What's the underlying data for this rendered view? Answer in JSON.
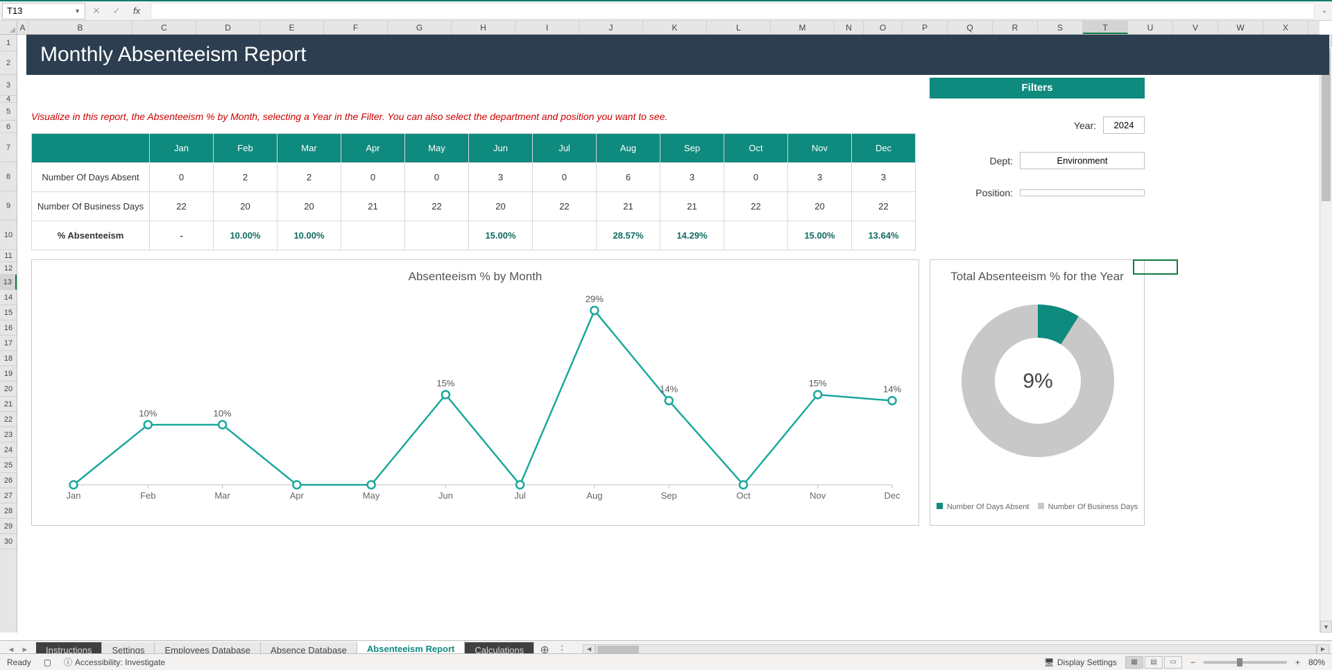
{
  "nameBox": "T13",
  "formulaBarValue": "",
  "columns": [
    "A",
    "B",
    "C",
    "D",
    "E",
    "F",
    "G",
    "H",
    "I",
    "J",
    "K",
    "L",
    "M",
    "N",
    "O",
    "P",
    "Q",
    "R",
    "S",
    "T",
    "U",
    "V",
    "W",
    "X"
  ],
  "selectedCol": "T",
  "rows": [
    1,
    2,
    3,
    4,
    5,
    6,
    7,
    8,
    9,
    10,
    11,
    12,
    13,
    14,
    15,
    16,
    17,
    18,
    19,
    20,
    21,
    22,
    23,
    24,
    25,
    26,
    27,
    28,
    29,
    30
  ],
  "selectedRow": 13,
  "title": "Monthly Absenteeism Report",
  "instruction": "Visualize in this report, the Absenteeism % by Month, selecting a Year in the Filter. You can also select the department and position you want to see.",
  "months": [
    "Jan",
    "Feb",
    "Mar",
    "Apr",
    "May",
    "Jun",
    "Jul",
    "Aug",
    "Sep",
    "Oct",
    "Nov",
    "Dec"
  ],
  "tableRows": {
    "absent": {
      "label": "Number Of Days Absent",
      "vals": [
        "0",
        "2",
        "2",
        "0",
        "0",
        "3",
        "0",
        "6",
        "3",
        "0",
        "3",
        "3"
      ]
    },
    "business": {
      "label": "Number Of Business Days",
      "vals": [
        "22",
        "20",
        "20",
        "21",
        "22",
        "20",
        "22",
        "21",
        "21",
        "22",
        "20",
        "22"
      ]
    },
    "pct": {
      "label": "% Absenteeism",
      "vals": [
        "-",
        "10.00%",
        "10.00%",
        "",
        "",
        "15.00%",
        "",
        "28.57%",
        "14.29%",
        "",
        "15.00%",
        "13.64%"
      ]
    }
  },
  "filters": {
    "header": "Filters",
    "yearLabel": "Year:",
    "yearValue": "2024",
    "deptLabel": "Dept:",
    "deptValue": "Environment",
    "posLabel": "Position:",
    "posValue": ""
  },
  "chart_data": [
    {
      "type": "line",
      "title": "Absenteeism % by Month",
      "categories": [
        "Jan",
        "Feb",
        "Mar",
        "Apr",
        "May",
        "Jun",
        "Jul",
        "Aug",
        "Sep",
        "Oct",
        "Nov",
        "Dec"
      ],
      "values": [
        0,
        10,
        10,
        0,
        0,
        15,
        0,
        29,
        14,
        0,
        15,
        14
      ],
      "data_labels": [
        "",
        "10%",
        "10%",
        "",
        "",
        "15%",
        "",
        "29%",
        "14%",
        "",
        "15%",
        "14%"
      ],
      "ylim": [
        0,
        30
      ],
      "ylabel": "",
      "xlabel": ""
    },
    {
      "type": "pie",
      "title": "Total Absenteeism % for the Year",
      "center_label": "9%",
      "series": [
        {
          "name": "Number Of Days Absent",
          "value": 9,
          "color": "#0f8a7e"
        },
        {
          "name": "Number Of Business Days",
          "value": 91,
          "color": "#c8c8c8"
        }
      ]
    }
  ],
  "sheetTabs": [
    {
      "name": "Instructions",
      "style": "dark"
    },
    {
      "name": "Settings",
      "style": ""
    },
    {
      "name": "Employees Database",
      "style": ""
    },
    {
      "name": "Absence Database",
      "style": ""
    },
    {
      "name": "Absenteeism Report",
      "style": "active"
    },
    {
      "name": "Calculations",
      "style": "dark"
    }
  ],
  "statusBar": {
    "ready": "Ready",
    "accessibility": "Accessibility: Investigate",
    "displaySettings": "Display Settings",
    "zoom": "80%"
  },
  "colWidths": {
    "A": 16,
    "default": 92,
    "N": 42,
    "O": 56,
    "rest": 65
  }
}
